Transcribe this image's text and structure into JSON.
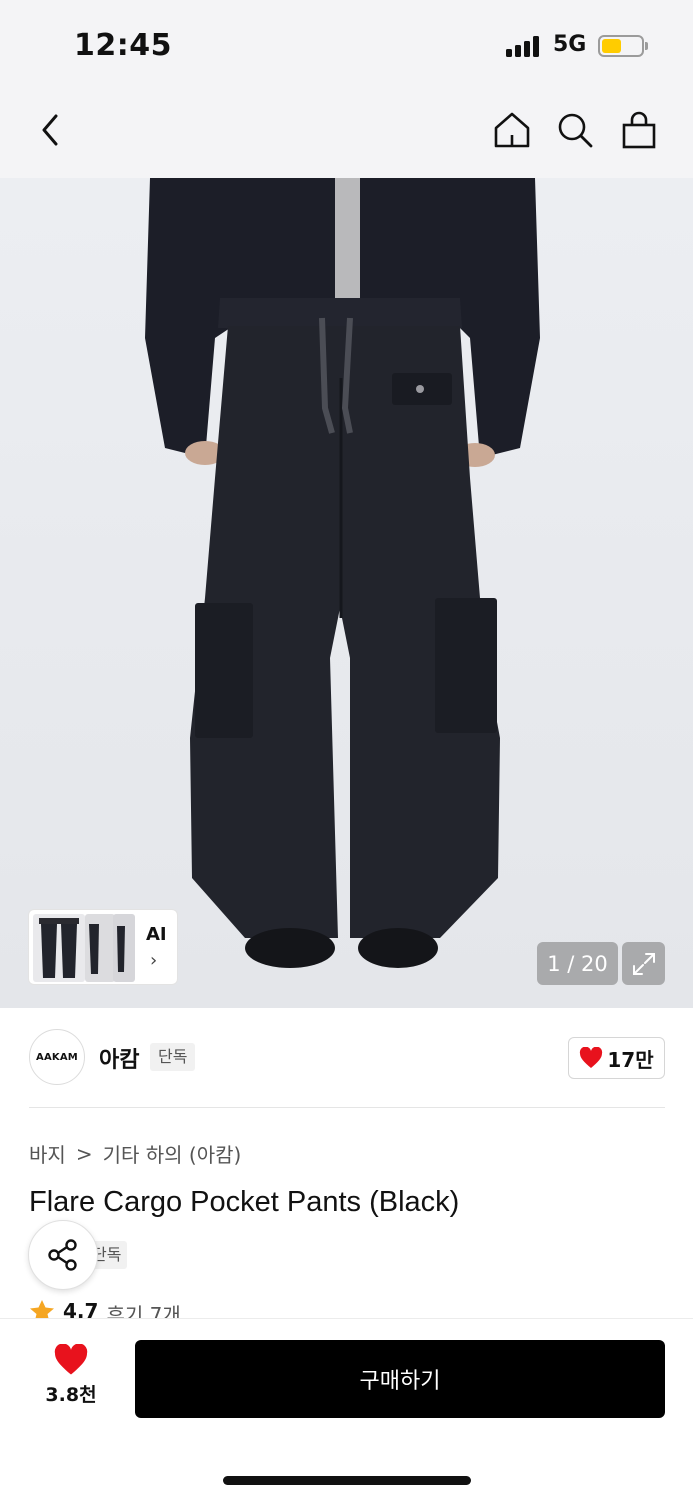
{
  "status_bar": {
    "time": "12:45",
    "network": "5G",
    "battery_level": 0.5,
    "battery_color": "#ffcc00"
  },
  "nav": {
    "icons": [
      "back-icon",
      "home-icon",
      "search-icon",
      "shopping-bag-icon"
    ]
  },
  "gallery": {
    "current": 1,
    "total": 20,
    "counter_text": "1 / 20",
    "ai_label": "AI",
    "ai_chevron": "›"
  },
  "brand": {
    "logo_text": "AAKAM",
    "name": "아캄",
    "badge": "단독",
    "likes": "17만"
  },
  "breadcrumb": {
    "category": "바지",
    "separator": ">",
    "subcategory": "기타 하의 (아캄)"
  },
  "product": {
    "title": "Flare Cargo Pocket Pants (Black)",
    "badge": "단독",
    "rating": "4.7",
    "reviews_label": "후기 7개"
  },
  "bottom_bar": {
    "wishlist_count": "3.8천",
    "buy_label": "구매하기"
  },
  "colors": {
    "accent": "#000000",
    "heart": "#e8121d",
    "star": "#f5a623"
  }
}
